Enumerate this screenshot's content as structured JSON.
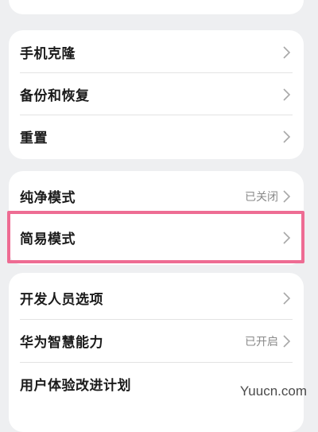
{
  "group_backup": {
    "items": [
      {
        "label": "手机克隆"
      },
      {
        "label": "备份和恢复"
      },
      {
        "label": "重置"
      }
    ]
  },
  "group_mode": {
    "items": [
      {
        "label": "纯净模式",
        "value": "已关闭"
      },
      {
        "label": "简易模式"
      }
    ]
  },
  "group_dev": {
    "items": [
      {
        "label": "开发人员选项"
      },
      {
        "label": "华为智慧能力",
        "value": "已开启"
      },
      {
        "label": "用户体验改进计划"
      }
    ]
  },
  "watermark": "Yuucn.com",
  "colors": {
    "highlight": "#ee6c93",
    "background": "#eeeff1",
    "card": "#ffffff"
  }
}
